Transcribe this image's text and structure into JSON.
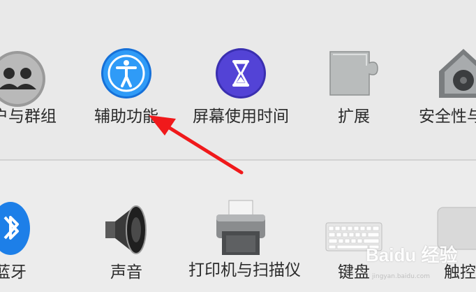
{
  "top_row": {
    "items": [
      {
        "label": "户与群组"
      },
      {
        "label": "辅助功能"
      },
      {
        "label": "屏幕使用时间"
      },
      {
        "label": "扩展"
      },
      {
        "label": "安全性与"
      }
    ]
  },
  "bottom_row": {
    "items": [
      {
        "label": "蓝牙"
      },
      {
        "label": "声音"
      },
      {
        "label": "打印机与扫描仪"
      },
      {
        "label": "键盘"
      },
      {
        "label": "触控"
      }
    ]
  },
  "colors": {
    "accessibility_blue": "#1f8ef5",
    "screen_time_purple": "#4c3ccf",
    "arrow_red": "#f0191b"
  },
  "watermark": {
    "text": "Baidu 经验",
    "sub": "jingyan.baidu.com"
  }
}
